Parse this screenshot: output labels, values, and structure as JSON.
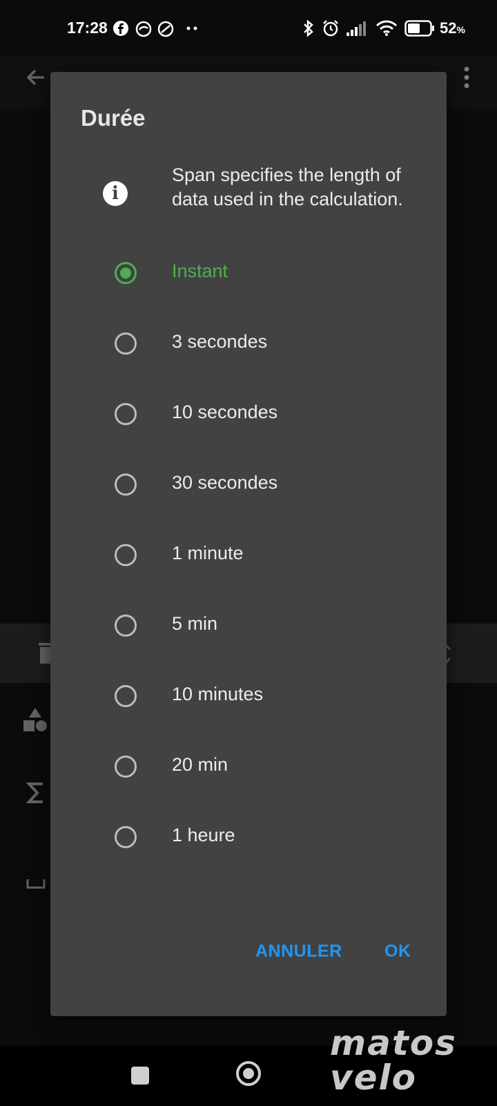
{
  "status_bar": {
    "time": "17:28",
    "battery_percent": "52",
    "battery_unit": "%",
    "icons": [
      "facebook-icon",
      "app-icon",
      "vpn-icon",
      "more-notifications-icon",
      "bluetooth-icon",
      "alarm-icon",
      "signal-icon",
      "wifi-icon",
      "battery-icon"
    ]
  },
  "dialog": {
    "title": "Durée",
    "info_text": "Span specifies the length of data used in the calculation.",
    "options": [
      {
        "label": "Instant",
        "selected": true
      },
      {
        "label": "3 secondes",
        "selected": false
      },
      {
        "label": "10 secondes",
        "selected": false
      },
      {
        "label": "30 secondes",
        "selected": false
      },
      {
        "label": "1 minute",
        "selected": false
      },
      {
        "label": "5 min",
        "selected": false
      },
      {
        "label": "10 minutes",
        "selected": false
      },
      {
        "label": "20 min",
        "selected": false
      },
      {
        "label": "1 heure",
        "selected": false
      }
    ],
    "cancel_label": "ANNULER",
    "ok_label": "OK"
  },
  "colors": {
    "accent_green": "#4caf50",
    "button_blue": "#2196f3",
    "dialog_background": "#424242"
  },
  "watermark": {
    "line1": "matos",
    "line2": "velo"
  }
}
